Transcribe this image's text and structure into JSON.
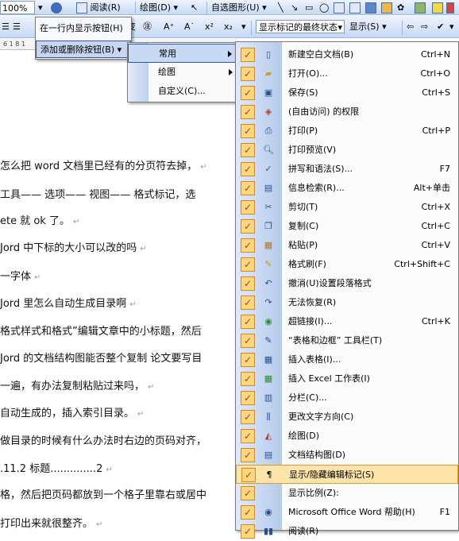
{
  "toolbar1": {
    "zoom": "100%",
    "read_label": "阅读(R)",
    "draw_label": "绘图(D)",
    "autoshape_label": "自选图形(U)"
  },
  "toolbar2": {
    "markup_dropdown": "显示标记的最终状态",
    "show_label": "显示(S)",
    "format_glyphs": [
      "A⁺",
      "A˙",
      "x²",
      "x₂"
    ]
  },
  "ruler": {
    "numbers": "6 1 8 1"
  },
  "menu_level1": {
    "items": [
      {
        "label": "在一行内显示按钮(H)"
      },
      {
        "label": "添加或删除按钮(B)"
      }
    ]
  },
  "menu_level2": {
    "items": [
      {
        "label": "常用"
      },
      {
        "label": "绘图"
      },
      {
        "label": "自定义(C)..."
      }
    ]
  },
  "menu_level3": {
    "items": [
      {
        "label": "新建空白文档(B)",
        "shortcut": "Ctrl+N",
        "icon": "new-doc-icon"
      },
      {
        "label": "打开(O)...",
        "shortcut": "Ctrl+O",
        "icon": "open-folder-icon"
      },
      {
        "label": "保存(S)",
        "shortcut": "Ctrl+S",
        "icon": "save-disk-icon"
      },
      {
        "label": "(自由访问) 的权限",
        "shortcut": "",
        "icon": "permission-icon"
      },
      {
        "label": "打印(P)",
        "shortcut": "Ctrl+P",
        "icon": "print-icon"
      },
      {
        "label": "打印预览(V)",
        "shortcut": "",
        "icon": "print-preview-icon"
      },
      {
        "label": "拼写和语法(S)...",
        "shortcut": "F7",
        "icon": "spelling-icon"
      },
      {
        "label": "信息检索(R)...",
        "shortcut": "Alt+单击",
        "icon": "research-icon"
      },
      {
        "label": "剪切(T)",
        "shortcut": "Ctrl+X",
        "icon": "scissors-icon"
      },
      {
        "label": "复制(C)",
        "shortcut": "Ctrl+C",
        "icon": "copy-icon"
      },
      {
        "label": "粘贴(P)",
        "shortcut": "Ctrl+V",
        "icon": "paste-icon"
      },
      {
        "label": "格式刷(F)",
        "shortcut": "Ctrl+Shift+C",
        "icon": "format-painter-icon"
      },
      {
        "label": "撤消(U)设置段落格式",
        "shortcut": "",
        "icon": "undo-icon"
      },
      {
        "label": "无法恢复(R)",
        "shortcut": "",
        "icon": "redo-icon"
      },
      {
        "label": "超链接(I)...",
        "shortcut": "Ctrl+K",
        "icon": "hyperlink-icon"
      },
      {
        "label": "“表格和边框” 工具栏(T)",
        "shortcut": "",
        "icon": "tables-borders-icon"
      },
      {
        "label": "插入表格(I)...",
        "shortcut": "",
        "icon": "insert-table-icon"
      },
      {
        "label": "插入 Excel 工作表(I)",
        "shortcut": "",
        "icon": "excel-sheet-icon"
      },
      {
        "label": "分栏(C)...",
        "shortcut": "",
        "icon": "columns-icon"
      },
      {
        "label": "更改文字方向(C)",
        "shortcut": "",
        "icon": "text-direction-icon"
      },
      {
        "label": "绘图(D)",
        "shortcut": "",
        "icon": "drawing-icon"
      },
      {
        "label": "文档结构图(D)",
        "shortcut": "",
        "icon": "document-map-icon"
      },
      {
        "label": "显示/隐藏编辑标记(S)",
        "shortcut": "",
        "icon": "show-hide-marks-icon"
      },
      {
        "label": "显示比例(Z):",
        "shortcut": "",
        "icon": "zoom-icon"
      },
      {
        "label": "Microsoft Office Word 帮助(H)",
        "shortcut": "F1",
        "icon": "help-icon"
      },
      {
        "label": "阅读(R)",
        "shortcut": "",
        "icon": "read-icon"
      }
    ]
  },
  "document": {
    "paragraph_mark": "↵",
    "lines": [
      "怎么把 word 文档里已经有的分页符去掉，",
      "工具—— 选项—— 视图—— 格式标记，选",
      "ete 就 ok 了。",
      "Jord 中下标的大小可以改的吗",
      "一字体",
      "Jord 里怎么自动生成目录啊",
      "格式样式和格式”编辑文章中的小标题，然后",
      "Jord 的文档结构图能否整个复制 论文要写目",
      "一遍，有办法复制粘贴过来吗，",
      "自动生成的，插入索引目录。",
      "做目录的时候有什么办法时右边的页码对齐，",
      ".11.2 标题..............2",
      "格，然后把页码都放到一个格子里靠右或居中",
      "打印出来就很整齐。"
    ]
  }
}
